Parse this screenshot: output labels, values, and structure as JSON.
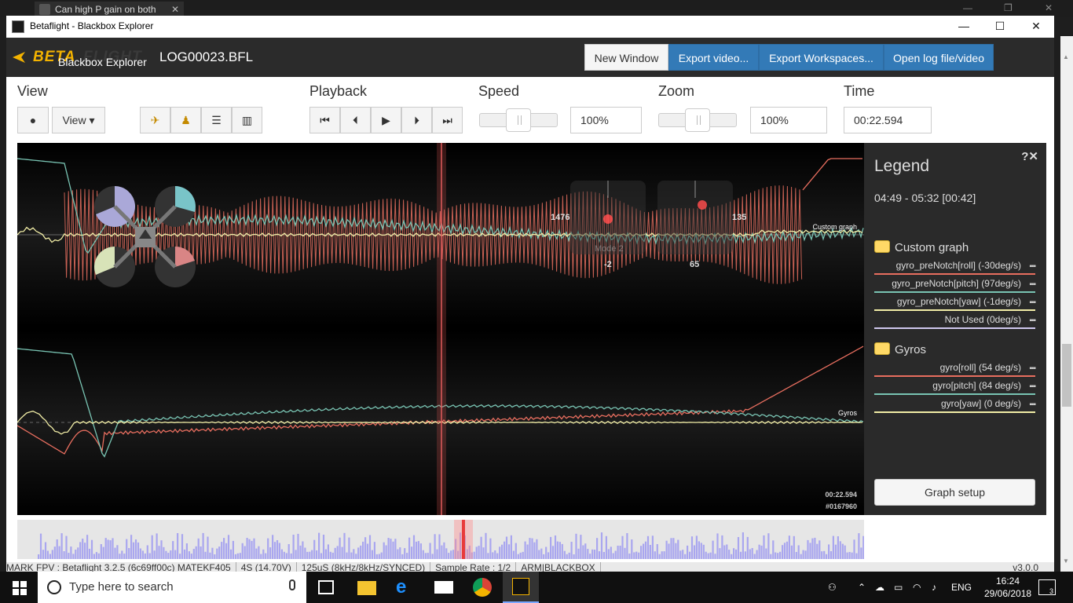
{
  "browser": {
    "tab_title": "Can high P gain on both"
  },
  "window": {
    "title": "Betaflight - Blackbox Explorer",
    "minimize": "—",
    "maximize": "☐",
    "close": "✕"
  },
  "header": {
    "logo_beta": "BETA",
    "logo_flight": "FLIGHT",
    "logo_sub": "Blackbox Explorer",
    "log_file": "LOG00023.BFL",
    "buttons": [
      "New Window",
      "Export video...",
      "Export Workspaces...",
      "Open log file/video"
    ]
  },
  "toolbar": {
    "view_label": "View",
    "view_dropdown": "View ▾",
    "playback_label": "Playback",
    "speed_label": "Speed",
    "speed_value": "100%",
    "speed_level": 0.5,
    "zoom_label": "Zoom",
    "zoom_value": "100%",
    "zoom_level": 0.5,
    "time_label": "Time",
    "time_value": "00:22.594"
  },
  "graph": {
    "custom_graph_label": "Custom graph",
    "gyros_label": "Gyros",
    "stick_left_value": "1476",
    "stick_right_value": "135",
    "stick_left_bottom": "-2",
    "stick_right_bottom": "65",
    "mode_label": "Mode 2",
    "time_readout": "00:22.594",
    "frame_readout": "#0167960",
    "colors": {
      "roll": "#e86e5f",
      "pitch": "#79c4b3",
      "yaw": "#f1eda6",
      "cursor": "#d9534f"
    }
  },
  "legend": {
    "title": "Legend",
    "range": "04:49 - 05:32 [00:42]",
    "help_icons": "?✕",
    "groups": [
      {
        "name": "Custom graph",
        "fields": [
          {
            "label": "gyro_preNotch[roll] (-30deg/s)",
            "color": "#e86e5f"
          },
          {
            "label": "gyro_preNotch[pitch] (97deg/s)",
            "color": "#79c4b3"
          },
          {
            "label": "gyro_preNotch[yaw] (-1deg/s)",
            "color": "#f1eda6"
          },
          {
            "label": "Not Used (0deg/s)",
            "color": "#d0c8ef"
          }
        ]
      },
      {
        "name": "Gyros",
        "fields": [
          {
            "label": "gyro[roll] (54 deg/s)",
            "color": "#e86e5f"
          },
          {
            "label": "gyro[pitch] (84 deg/s)",
            "color": "#79c4b3"
          },
          {
            "label": "gyro[yaw] (0 deg/s)",
            "color": "#f1eda6"
          }
        ]
      }
    ],
    "graph_setup": "Graph setup"
  },
  "status_bar": {
    "items": [
      "MARK FPV : Betaflight 3.2.5 (6c69ff00c) MATEKF405",
      "4S (14.70V)",
      "125uS (8kHz/8kHz/SYNCED)",
      "Sample Rate : 1/2",
      "ARM|BLACKBOX"
    ],
    "version": "v3.0.0"
  },
  "taskbar": {
    "search_placeholder": "Type here to search",
    "language": "ENG",
    "time": "16:24",
    "date": "29/06/2018",
    "notifications": "3"
  }
}
